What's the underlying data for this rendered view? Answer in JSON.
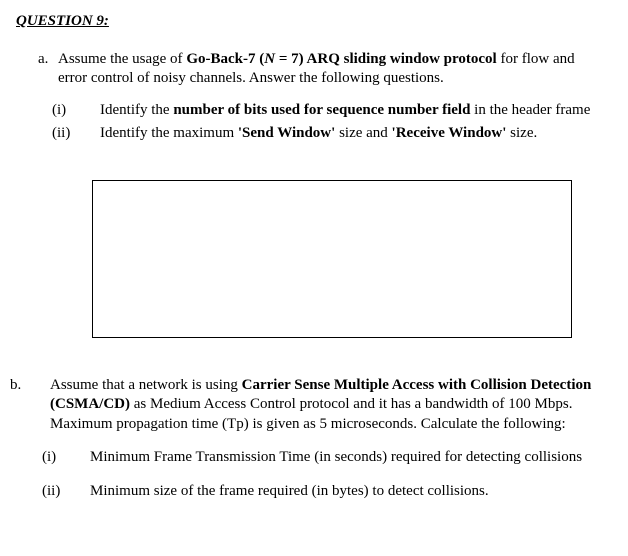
{
  "heading": "QUESTION 9:",
  "partA": {
    "label": "a.",
    "intro_pre": "Assume the usage of ",
    "intro_bold1": "Go-Back-7 (",
    "intro_italic": "N",
    "intro_bold2": " = 7) ARQ sliding window protocol",
    "intro_post": " for flow and error control of noisy channels. Answer the following questions.",
    "items": [
      {
        "label": "(i)",
        "pre": "Identify the ",
        "bold": "number of bits used for sequence number field",
        "post": " in the header frame"
      },
      {
        "label": "(ii)",
        "pre": "Identify the maximum ",
        "bold1": "'Send Window'",
        "mid": " size and ",
        "bold2": "'Receive Window'",
        "post": " size."
      }
    ]
  },
  "partB": {
    "label": "b.",
    "intro_pre": "Assume that a network is using ",
    "intro_bold": "Carrier Sense Multiple Access with Collision Detection (CSMA/CD)",
    "intro_post": " as Medium Access Control protocol and it has a bandwidth of 100 Mbps. Maximum propagation time (Tp) is given as 5 microseconds. Calculate the following:",
    "items": [
      {
        "label": "(i)",
        "text": "Minimum Frame Transmission Time (in seconds) required for detecting collisions"
      },
      {
        "label": "(ii)",
        "text": "Minimum size of the frame required (in bytes) to detect collisions."
      }
    ]
  }
}
